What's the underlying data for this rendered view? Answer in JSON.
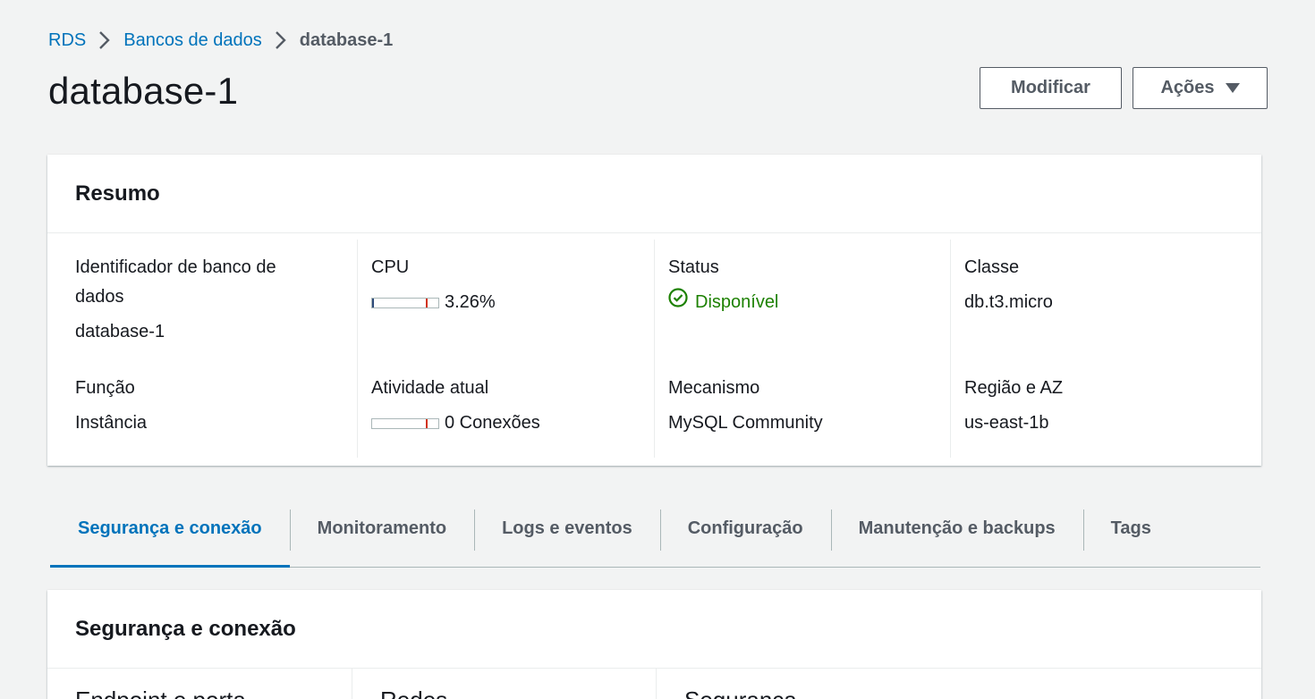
{
  "breadcrumb": {
    "items": [
      "RDS",
      "Bancos de dados"
    ],
    "current": "database-1"
  },
  "page": {
    "title": "database-1"
  },
  "header_buttons": {
    "modify": "Modificar",
    "actions": "Ações"
  },
  "summary": {
    "title": "Resumo",
    "fields": {
      "db_identifier": {
        "label": "Identificador de banco de dados",
        "value": "database-1"
      },
      "cpu": {
        "label": "CPU",
        "value": "3.26%",
        "fill_percent": 3.26
      },
      "status": {
        "label": "Status",
        "value": "Disponível",
        "color": "#1d8102"
      },
      "class": {
        "label": "Classe",
        "value": "db.t3.micro"
      },
      "role": {
        "label": "Função",
        "value": "Instância"
      },
      "activity": {
        "label": "Atividade atual",
        "value": "0 Conexões",
        "fill_percent": 0
      },
      "engine": {
        "label": "Mecanismo",
        "value": "MySQL Community"
      },
      "region": {
        "label": "Região e AZ",
        "value": "us-east-1b"
      }
    }
  },
  "tabs": [
    {
      "label": "Segurança e conexão",
      "active": true
    },
    {
      "label": "Monitoramento",
      "active": false
    },
    {
      "label": "Logs e eventos",
      "active": false
    },
    {
      "label": "Configuração",
      "active": false
    },
    {
      "label": "Manutenção e backups",
      "active": false
    },
    {
      "label": "Tags",
      "active": false
    }
  ],
  "connection": {
    "title": "Segurança e conexão",
    "columns": [
      "Endpoint e porta",
      "Redes",
      "Segurança"
    ]
  },
  "colors": {
    "link": "#0073bb",
    "active_tab": "#0073bb",
    "success": "#1d8102",
    "meter_fill": "#2e4b7a",
    "meter_threshold": "#d13212"
  },
  "icons": {
    "breadcrumb_separator": "chevron-right-icon",
    "actions_caret": "caret-down-icon",
    "status": "check-circle-icon"
  }
}
